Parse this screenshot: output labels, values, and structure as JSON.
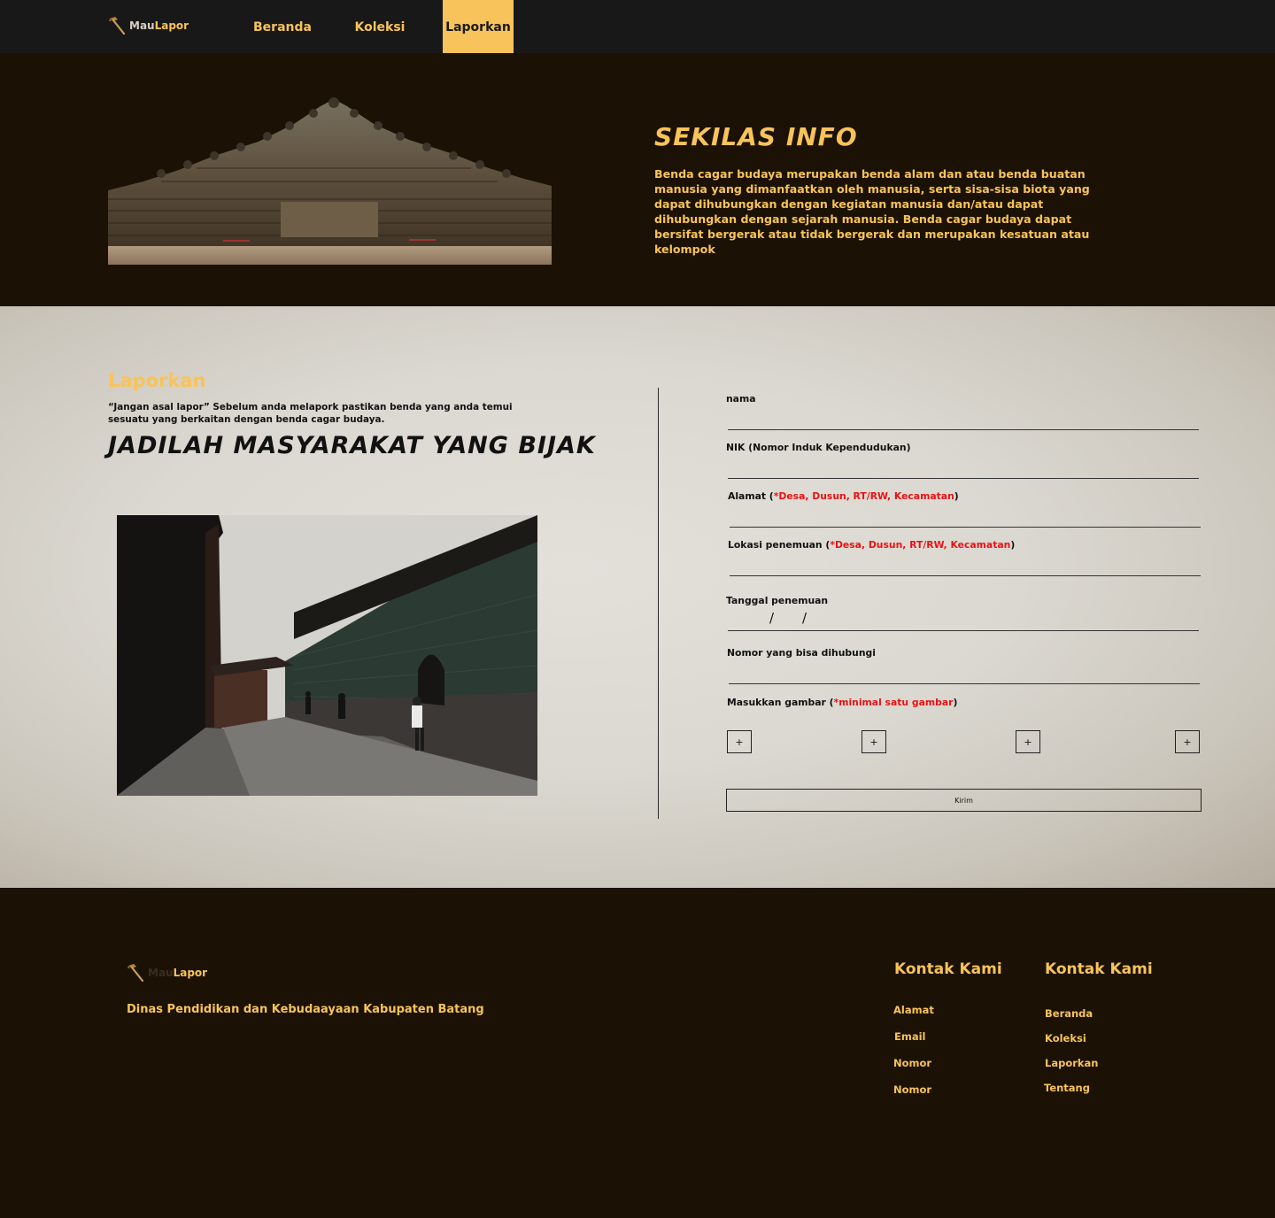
{
  "colors": {
    "accent": "#f8c35b",
    "nav_bg": "#181818",
    "dark_bg": "#1b1205",
    "required": "#e81313"
  },
  "nav": {
    "brand": {
      "part1": "Mau",
      "part2": "Lapor",
      "icon": "pickaxe-icon"
    },
    "links": [
      "Beranda",
      "Koleksi",
      "Laporkan"
    ],
    "active": "Laporkan"
  },
  "hero": {
    "title": "SEKILAS INFO",
    "text": "Benda cagar budaya merupakan benda alam dan atau benda buatan manusia yang dimanfaatkan oleh manusia, serta sisa-sisa biota yang dapat dihubungkan dengan kegiatan manusia dan/atau dapat dihubungkan dengan sejarah manusia. Benda cagar budaya dapat bersifat bergerak atau tidak bergerak dan  merupakan kesatuan atau kelompok"
  },
  "report": {
    "title": "Laporkan",
    "quote": "“Jangan asal lapor” Sebelum anda melapork pastikan benda yang anda temui sesuatu yang berkaitan dengan benda cagar budaya.",
    "slogan": "JADILAH MASYARAKAT  YANG BIJAK"
  },
  "form": {
    "nama": {
      "label": "nama",
      "value": ""
    },
    "nik": {
      "label": "NIK (Nomor Induk Kependudukan)",
      "value": ""
    },
    "alamat": {
      "label": "Alamat",
      "required": "*Desa, Dusun, RT/RW, Kecamatan",
      "value": ""
    },
    "lokasi": {
      "label": "Lokasi penemuan",
      "required": "*Desa, Dusun, RT/RW, Kecamatan",
      "value": ""
    },
    "tanggal": {
      "label": "Tanggal penemuan",
      "separator": "/"
    },
    "nomor": {
      "label": "Nomor yang bisa dihubungi",
      "value": ""
    },
    "gambar": {
      "label": "Masukkan gambar",
      "required": "*minimal satu gambar",
      "button": "+"
    },
    "submit": "Kirim"
  },
  "footer": {
    "brand": {
      "part1": "Mau",
      "part2": "Lapor"
    },
    "org": "Dinas Pendidikan dan Kebudaayaan  Kabupaten Batang",
    "col1": {
      "title": "Kontak Kami",
      "items": [
        "Alamat",
        "Email",
        "Nomor",
        "Nomor"
      ]
    },
    "col2": {
      "title": "Kontak Kami",
      "items": [
        "Beranda",
        "Koleksi",
        "Laporkan",
        "Tentang"
      ]
    }
  }
}
